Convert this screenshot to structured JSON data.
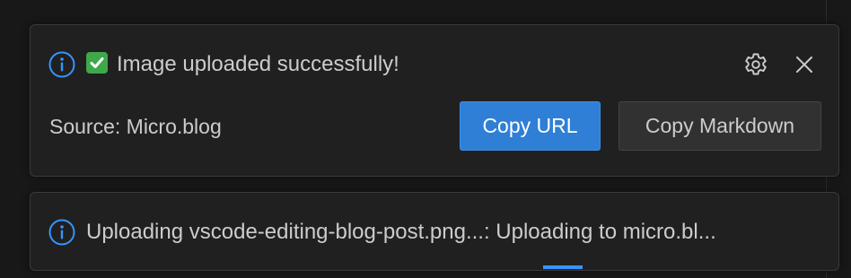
{
  "notifications": [
    {
      "message": "Image uploaded successfully!",
      "icon": "info-icon",
      "emoji": "check-mark-emoji",
      "source": "Source: Micro.blog",
      "actions": {
        "primary": "Copy URL",
        "secondary": "Copy Markdown"
      },
      "controls": [
        "gear-icon",
        "close-icon"
      ]
    },
    {
      "message": "Uploading vscode-editing-blog-post.png...: Uploading to micro.bl...",
      "icon": "info-icon",
      "progress": "indeterminate"
    }
  ],
  "colors": {
    "background": "#181818",
    "toast_background": "#202020",
    "primary_button": "#2f7fd6",
    "info_icon": "#3794ff",
    "progress": "#3794ff"
  }
}
